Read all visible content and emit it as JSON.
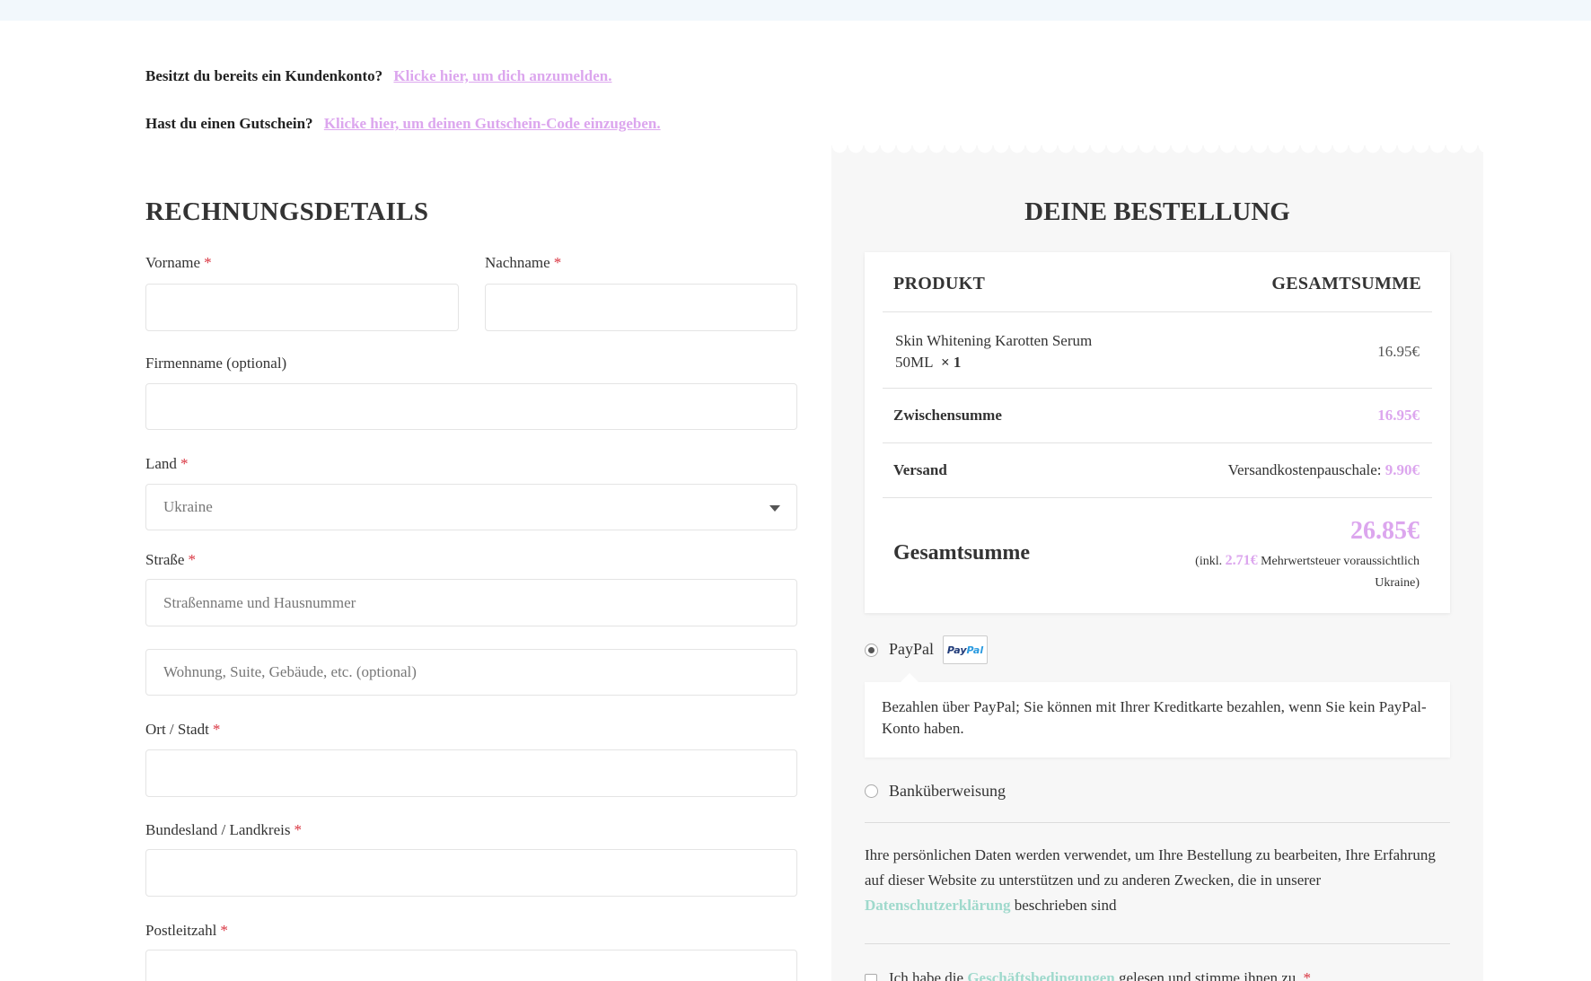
{
  "notices": {
    "login_question": "Besitzt du bereits ein Kundenkonto?",
    "login_link": "Klicke hier, um dich anzumelden.",
    "coupon_question": "Hast du einen Gutschein?",
    "coupon_link": "Klicke hier, um deinen Gutschein-Code einzugeben."
  },
  "billing": {
    "title": "RECHNUNGSDETAILS",
    "required_mark": "*",
    "first_name_label": "Vorname",
    "last_name_label": "Nachname",
    "company_label": "Firmenname (optional)",
    "country_label": "Land",
    "country_value": "Ukraine",
    "street_label": "Straße",
    "street_placeholder": "Straßenname und Hausnummer",
    "street2_placeholder": "Wohnung, Suite, Gebäude, etc. (optional)",
    "city_label": "Ort / Stadt",
    "state_label": "Bundesland / Landkreis",
    "zip_label": "Postleitzahl"
  },
  "order": {
    "title": "DEINE BESTELLUNG",
    "col_product": "PRODUKT",
    "col_total": "GESAMTSUMME",
    "item_name_line1": "Skin Whitening Karotten Serum",
    "item_name_line2": "50ML",
    "item_qty": "× 1",
    "item_price": "16.95€",
    "subtotal_label": "Zwischensumme",
    "subtotal_value": "16.95€",
    "shipping_label": "Versand",
    "shipping_method": "Versandkostenpauschale:",
    "shipping_value": "9.90€",
    "total_label": "Gesamtsumme",
    "total_value": "26.85€",
    "tax_prefix": "(inkl.",
    "tax_value": "2.71€",
    "tax_suffix": "Mehrwertsteuer voraussichtlich",
    "tax_country": "Ukraine)"
  },
  "payment": {
    "paypal_label": "PayPal",
    "paypal_logo_a": "Pay",
    "paypal_logo_b": "Pal",
    "paypal_description": "Bezahlen über PayPal; Sie können mit Ihrer Kreditkarte bezahlen, wenn Sie kein PayPal-Konto haben.",
    "bank_label": "Banküberweisung"
  },
  "privacy": {
    "text_before": "Ihre persönlichen Daten werden verwendet, um Ihre Bestellung zu bearbeiten, Ihre Erfahrung auf dieser Website zu unterstützen und zu anderen Zwecken, die in unserer",
    "link": "Datenschutzerklärung",
    "text_after": "beschrieben sind"
  },
  "terms": {
    "text_before": "Ich habe die",
    "link": "Geschäftsbedingungen",
    "text_after": "gelesen und stimme ihnen zu",
    "required_mark": "*"
  },
  "colors": {
    "accent_pink": "#dca6ee",
    "accent_teal": "#9fd9cc",
    "required_red": "#d9333f"
  }
}
